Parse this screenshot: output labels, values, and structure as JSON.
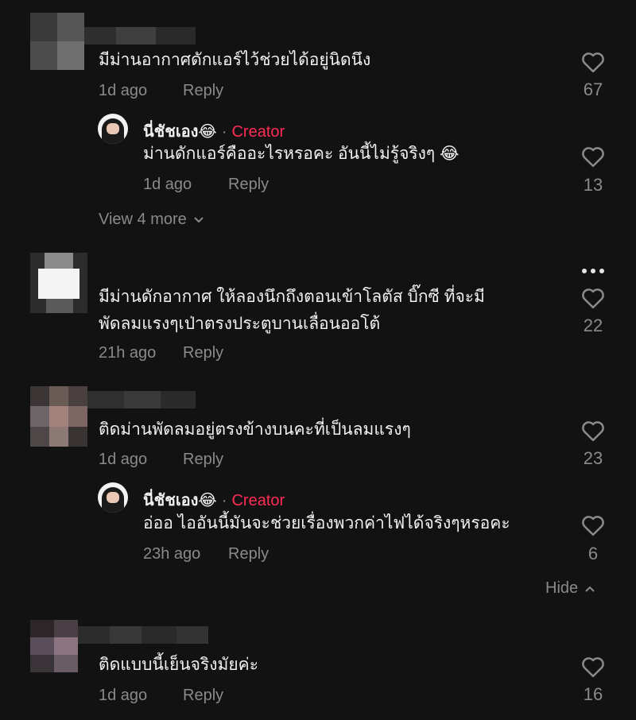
{
  "comments": [
    {
      "text": "มีม่านอากาศดักแอร์ไว้ช่วยได้อยู่นิดนึง",
      "time": "1d ago",
      "reply_label": "Reply",
      "likes": "67",
      "replies": [
        {
          "author": "นี่ชัชเอง😂",
          "separator": "·",
          "badge": "Creator",
          "text": "ม่านดักแอร์คืออะไรหรอคะ อันนี้ไม่รู้จริงๆ 😂",
          "time": "1d ago",
          "reply_label": "Reply",
          "likes": "13"
        }
      ],
      "view_more_label": "View 4 more"
    },
    {
      "text_line1": "มีม่านดักอากาศ ให้ลองนึกถึงตอนเข้าโลตัส บิ๊กซี ที่จะมี",
      "text_line2": "พัดลมแรงๆเป่าตรงประตูบานเลื่อนออโต้",
      "time": "21h ago",
      "reply_label": "Reply",
      "likes": "22"
    },
    {
      "text": "ติดม่านพัดลมอยู่ตรงข้างบนคะที่เป็นลมแรงๆ",
      "time": "1d ago",
      "reply_label": "Reply",
      "likes": "23",
      "replies": [
        {
          "author": "นี่ชัชเอง😂",
          "separator": "·",
          "badge": "Creator",
          "text": "อ่ออ ไออันนี้มันจะช่วยเรื่องพวกค่าไฟได้จริงๆหรอคะ",
          "time": "23h ago",
          "reply_label": "Reply",
          "likes": "6"
        }
      ],
      "hide_label": "Hide"
    },
    {
      "text": "ติดแบบนี้เย็นจริงมัยค่ะ",
      "time": "1d ago",
      "reply_label": "Reply",
      "likes": "16"
    }
  ],
  "colors": {
    "background": "#121212",
    "text": "#f1f1f1",
    "muted": "#8a8a8a",
    "creator": "#fe2c55"
  },
  "icons": {
    "like": "heart-outline-icon",
    "more": "more-horizontal-icon",
    "expand": "chevron-down-icon",
    "collapse": "chevron-up-icon"
  }
}
